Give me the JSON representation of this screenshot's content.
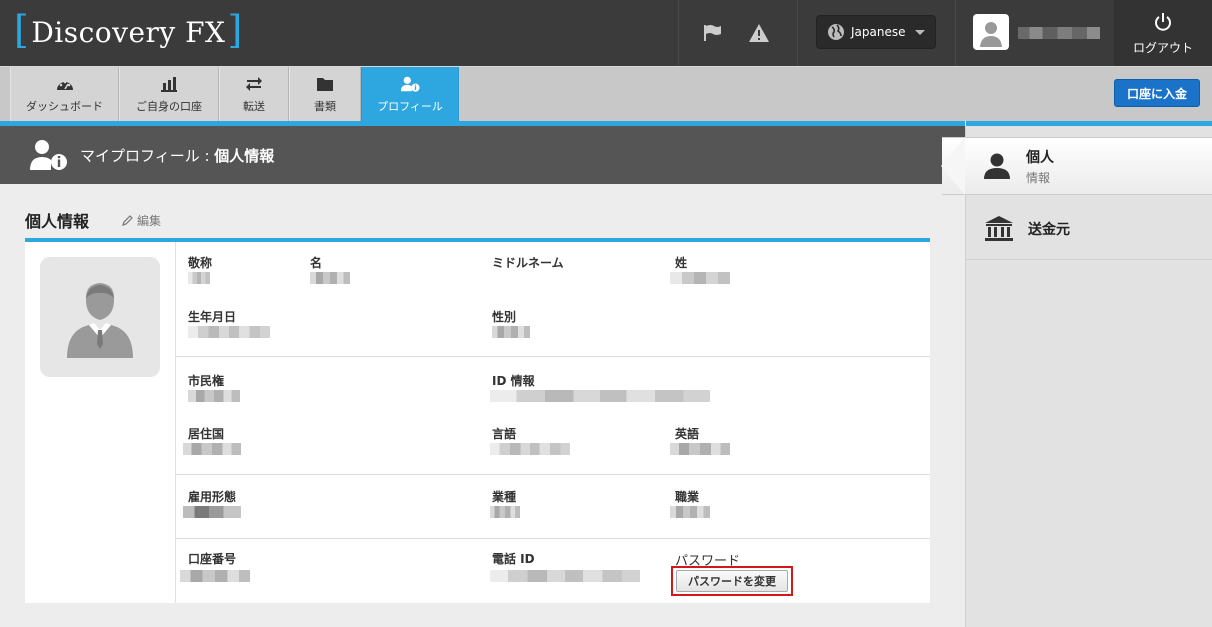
{
  "brand": {
    "name": "Discovery FX",
    "bracket_open": "[",
    "bracket_close": "]",
    "accent_color": "#2ea6e0"
  },
  "topbar": {
    "icons": [
      "flag-icon",
      "warning-icon"
    ],
    "language": {
      "selected": "Japanese",
      "icon": "globe-icon"
    },
    "user": {
      "avatar_icon": "user-avatar-icon"
    },
    "logout": {
      "label": "ログアウト",
      "icon": "power-icon"
    }
  },
  "nav": {
    "tabs": [
      {
        "label": "ダッシュボード",
        "icon": "dashboard-icon",
        "active": false
      },
      {
        "label": "ご自身の口座",
        "icon": "bar-chart-icon",
        "active": false
      },
      {
        "label": "転送",
        "icon": "transfer-icon",
        "active": false
      },
      {
        "label": "書類",
        "icon": "folder-icon",
        "active": false
      },
      {
        "label": "プロフィール",
        "icon": "profile-info-icon",
        "active": true
      }
    ],
    "deposit_button": "口座に入金"
  },
  "page_header": {
    "prefix": "マイプロフィール : ",
    "title": "個人情報",
    "icon": "profile-info-icon"
  },
  "section": {
    "title": "個人情報",
    "edit_label": "編集"
  },
  "fields": {
    "salutation": "敬称",
    "first_name": "名",
    "middle_name": "ミドルネーム",
    "last_name": "姓",
    "birth_date": "生年月日",
    "gender": "性別",
    "citizenship": "市民権",
    "id_info": "ID 情報",
    "country": "居住国",
    "language": "言語",
    "english": "英語",
    "employment": "雇用形態",
    "industry": "業種",
    "occupation": "職業",
    "account_number": "口座番号",
    "phone_id": "電話 ID",
    "password": "パスワード",
    "change_password_button": "パスワードを変更"
  },
  "sidebar": {
    "items": [
      {
        "label": "個人",
        "sublabel": "情報",
        "icon": "person-icon",
        "active": true
      },
      {
        "label": "送金元",
        "icon": "bank-icon",
        "active": false
      }
    ]
  }
}
